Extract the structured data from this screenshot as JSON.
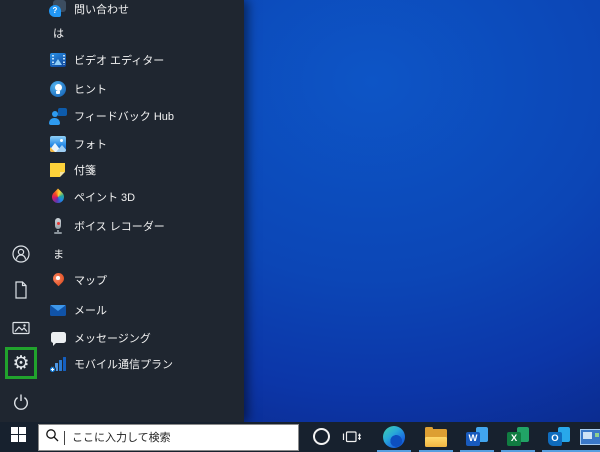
{
  "start_menu": {
    "items": [
      {
        "label": "問い合わせ",
        "type": "app",
        "icon": "get-help-icon"
      },
      {
        "label": "は",
        "type": "section-header"
      },
      {
        "label": "ビデオ エディター",
        "type": "app",
        "icon": "video-editor-icon"
      },
      {
        "label": "ヒント",
        "type": "app",
        "icon": "tips-icon"
      },
      {
        "label": "フィードバック Hub",
        "type": "app",
        "icon": "feedback-hub-icon"
      },
      {
        "label": "フォト",
        "type": "app",
        "icon": "photos-icon"
      },
      {
        "label": "付箋",
        "type": "app",
        "icon": "sticky-notes-icon"
      },
      {
        "label": "ペイント 3D",
        "type": "app",
        "icon": "paint-3d-icon"
      },
      {
        "label": "ボイス レコーダー",
        "type": "app",
        "icon": "voice-recorder-icon"
      },
      {
        "label": "ま",
        "type": "section-header"
      },
      {
        "label": "マップ",
        "type": "app",
        "icon": "maps-icon"
      },
      {
        "label": "メール",
        "type": "app",
        "icon": "mail-icon"
      },
      {
        "label": "メッセージング",
        "type": "app",
        "icon": "messaging-icon"
      },
      {
        "label": "モバイル通信プラン",
        "type": "app",
        "icon": "mobile-plans-icon"
      }
    ],
    "rail_items": [
      "user",
      "documents",
      "pictures",
      "settings",
      "power"
    ],
    "highlight": {
      "target": "settings",
      "color": "#21a32d"
    }
  },
  "icons": {
    "get_help_mark": "?"
  },
  "taskbar": {
    "search": {
      "placeholder": "ここに入力して検索"
    },
    "app_letters": {
      "word": "W",
      "excel": "X",
      "outlook": "O"
    },
    "buttons": [
      "start",
      "search",
      "cortana",
      "task-view",
      "edge",
      "file-explorer",
      "word",
      "excel",
      "outlook",
      "app-window"
    ],
    "running_indicator_color": "#569fe0"
  },
  "desktop": {
    "wallpaper_primary": "#0c45b8",
    "wallpaper_dark": "#081a4e"
  }
}
